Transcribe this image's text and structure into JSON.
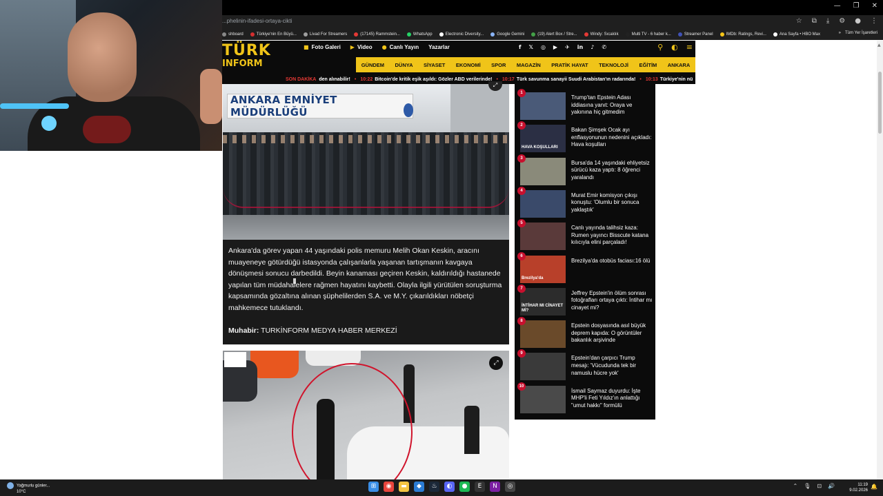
{
  "browser": {
    "url": "...phelinin-ifadesi-ortaya-cikti",
    "bookmarks": [
      {
        "label": "shboard",
        "color": "#888888"
      },
      {
        "label": "Türkiye'nin En Büyü...",
        "color": "#d32f2f"
      },
      {
        "label": "Livad For Streamers",
        "color": "#9e9e9e"
      },
      {
        "label": "(17145) Rammstein...",
        "color": "#e53935"
      },
      {
        "label": "WhatsApp",
        "color": "#25d366"
      },
      {
        "label": "Electronic Diversity...",
        "color": "#ffffff"
      },
      {
        "label": "Google Gemini",
        "color": "#8ab4f8"
      },
      {
        "label": "(19) Alert Box / Stre...",
        "color": "#43a047"
      },
      {
        "label": "Windy: Sıcaklık",
        "color": "#e53935"
      },
      {
        "label": "Multi TV - 6 haber k...",
        "color": "#222222"
      },
      {
        "label": "Streamer Panel",
        "color": "#3f51b5"
      },
      {
        "label": "IMDb: Ratings, Revi...",
        "color": "#f5c518"
      },
      {
        "label": "Ana Sayfa • HBO Max",
        "color": "#ffffff"
      }
    ],
    "bookmarks_more": "»",
    "all_bookmarks": "Tüm Yer İşaretleri"
  },
  "site": {
    "logo_line1": "TÜRK",
    "logo_line2": "INFORM",
    "topnav": [
      {
        "icon": "■",
        "label": "Foto Galeri"
      },
      {
        "icon": "▶",
        "label": "Video"
      },
      {
        "icon": "●",
        "label": "Canlı Yayın"
      },
      {
        "icon": "",
        "label": "Yazarlar"
      }
    ],
    "socials": [
      "f",
      "𝕏",
      "◎",
      "▶",
      "✈",
      "in",
      "♪",
      "✆"
    ],
    "categories": [
      "GÜNDEM",
      "DÜNYA",
      "SİYASET",
      "EKONOMİ",
      "SPOR",
      "MAGAZİN",
      "PRATİK HAYAT",
      "TEKNOLOJİ",
      "EĞİTİM",
      "ANKARA"
    ],
    "accent": "#f0c419"
  },
  "ticker": {
    "label": "SON DAKİKA",
    "items": [
      {
        "time": "",
        "text": "den alınabilir!"
      },
      {
        "time": "10:22",
        "text": "Bitcoin'de kritik eşik aşıldı: Gözler ABD verilerinde!"
      },
      {
        "time": "10:17",
        "text": "Türk savunma sanayii Suudi Arabistan'ın radarında!"
      },
      {
        "time": "10:13",
        "text": "Türkiye'nin nü"
      }
    ]
  },
  "article": {
    "photo1_sign": "ANKARA EMNİYET MÜDÜRLÜĞÜ",
    "body": "Ankara'da görev yapan 44 yaşındaki polis memuru Melih Okan Keskin, aracını muayeneye götürdüğü istasyonda çalışanlarla yaşanan tartışmanın kavgaya dönüşmesi sonucu darbedildi. Beyin kanaması geçiren Keskin, kaldırıldığı hastanede yapılan tüm müdahalelere rağmen hayatını kaybetti. Olayla ilgili yürütülen soruşturma kapsamında gözaltına alınan şüphelilerden S.A. ve M.Y. çıkarıldıkları nöbetçi mahkemece tutuklandı.",
    "reporter_label": "Muhabir:",
    "reporter_name": "TURKİNFORM MEDYA HABER MERKEZİ"
  },
  "most_read": [
    {
      "num": "1",
      "title": "Trump'tan Epstein Adası iddiasına yanıt: Oraya ve yakınına hiç gitmedim",
      "thumb": "#4a5a78"
    },
    {
      "num": "2",
      "title": "Bakan Şimşek Ocak ayı enflasyonunun nedenini açıkladı: Hava koşulları",
      "thumb": "#2b2f44",
      "thumb_text": "HAVA KOŞULLARI"
    },
    {
      "num": "3",
      "title": "Bursa'da 14 yaşındaki ehliyetsiz sürücü kaza yaptı: 8 öğrenci yaralandı",
      "thumb": "#8a8a7a"
    },
    {
      "num": "4",
      "title": "Murat Emir komisyon çıkışı konuştu: 'Olumlu bir sonuca yaklaştık'",
      "thumb": "#3a4a6a"
    },
    {
      "num": "5",
      "title": "Canlı yayında talihsiz kaza: Rumen yayıncı Bisscute katana kılıcıyla elini parçaladı!",
      "thumb": "#5a3a3a"
    },
    {
      "num": "6",
      "title": "Brezilya'da otobüs faciası:16 ölü",
      "thumb": "#b8402a",
      "thumb_text": "Brezilya'da"
    },
    {
      "num": "7",
      "title": "Jeffrey Epstein'in ölüm sonrası fotoğrafları ortaya çıktı: İntihar mı cinayet mi?",
      "thumb": "#2c2c2c",
      "thumb_text": "İNTİHAR MI CİNAYET Mİ?"
    },
    {
      "num": "8",
      "title": "Epstein dosyasında asıl büyük deprem kapıda: O görüntüler bakanlık arşivinde",
      "thumb": "#6a4a2a"
    },
    {
      "num": "9",
      "title": "Epstein'dan çarpıcı Trump mesajı: 'Vücudunda tek bir namuslu hücre yok'",
      "thumb": "#3a3a3a"
    },
    {
      "num": "10",
      "title": "İsmail Saymaz duyurdu: İşte MHP'li Feti Yıldız'ın anlattığı \"umut hakkı\" formülü",
      "thumb": "#4a4a4a"
    }
  ],
  "taskbar": {
    "weather_line1": "Yağmurlu günler...",
    "weather_line2": "10°C",
    "apps": [
      {
        "icon": "windows-icon",
        "glyph": "⊞",
        "color": "#3a8ee6"
      },
      {
        "icon": "chrome-icon",
        "glyph": "◉",
        "color": "#e8453c"
      },
      {
        "icon": "folder-icon",
        "glyph": "▬",
        "color": "#f4c542"
      },
      {
        "icon": "app-icon",
        "glyph": "◆",
        "color": "#2b7cd3"
      },
      {
        "icon": "steam-icon",
        "glyph": "♨",
        "color": "#1b2838"
      },
      {
        "icon": "discord-icon",
        "glyph": "◐",
        "color": "#5865f2"
      },
      {
        "icon": "spotify-icon",
        "glyph": "●",
        "color": "#1db954"
      },
      {
        "icon": "epic-icon",
        "glyph": "E",
        "color": "#333333"
      },
      {
        "icon": "next-icon",
        "glyph": "N",
        "color": "#7b1fa2"
      },
      {
        "icon": "obs-icon",
        "glyph": "◎",
        "color": "#444444"
      }
    ],
    "time": "11:19",
    "date": "9.02.2026"
  }
}
